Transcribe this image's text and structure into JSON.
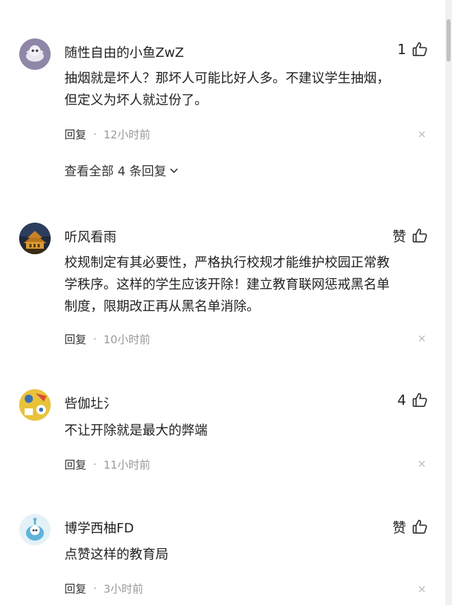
{
  "comments": [
    {
      "username": "随性自由的小鱼ZwZ",
      "like_label": "1",
      "text_lines": [
        "抽烟就是坏人？那坏人可能比好人多。不建议学生抽烟，",
        "但定义为坏人就过份了。"
      ],
      "reply_label": "回复",
      "dot": "·",
      "time": "12小时前"
    },
    {
      "username": "听风看雨",
      "like_label": "赞",
      "text_lines": [
        "校规制定有其必要性，严格执行校规才能维护校园正常教",
        "学秩序。这样的学生应该开除！建立教育联网惩戒黑名单",
        "制度，限期改正再从黑名单消除。"
      ],
      "reply_label": "回复",
      "dot": "·",
      "time": "10小时前"
    },
    {
      "username": "呰伽圵氵",
      "like_label": "4",
      "text_lines": [
        "不让开除就是最大的弊端"
      ],
      "reply_label": "回复",
      "dot": "·",
      "time": "11小时前"
    },
    {
      "username": "博学西柚FD",
      "like_label": "赞",
      "text_lines": [
        "点赞这样的教育局"
      ],
      "reply_label": "回复",
      "dot": "·",
      "time": "3小时前"
    }
  ],
  "view_replies": "查看全部 4 条回复",
  "colors": {
    "text": "#222222",
    "meta": "#999999",
    "like_icon": "#333333"
  }
}
